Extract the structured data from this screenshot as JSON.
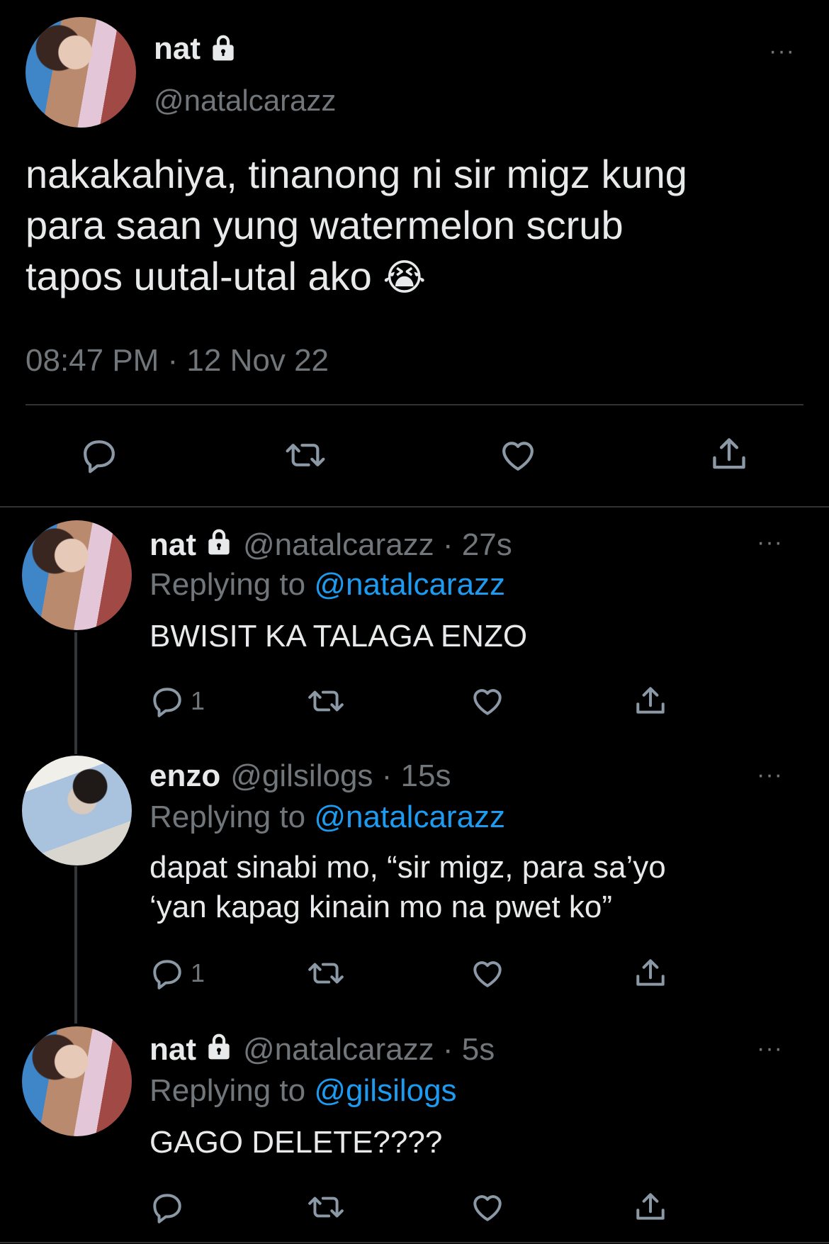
{
  "main_tweet": {
    "name": "nat",
    "handle": "@natalcarazz",
    "text_line1": "nakakahiya, tinanong ni sir migz kung",
    "text_line2": "para saan yung watermelon scrub",
    "text_line3": "tapos uutal-utal ako",
    "emoji": "😭",
    "timestamp": "08:47 PM · 12 Nov 22",
    "more_label": "···",
    "icons": [
      "reply-icon",
      "retweet-icon",
      "like-icon",
      "share-icon"
    ]
  },
  "replies": [
    {
      "name": "nat",
      "handle_time": "@natalcarazz · 27s",
      "replying_label": "Replying to",
      "replying_to": "@natalcarazz",
      "text_line1": "BWISIT KA TALAGA ENZO",
      "text_line2": "",
      "reply_count": "1",
      "more_label": "···"
    },
    {
      "name": "enzo",
      "handle_time": "@gilsilogs · 15s",
      "replying_label": "Replying to",
      "replying_to": "@natalcarazz",
      "text_line1": "dapat sinabi mo, “sir migz, para sa’yo",
      "text_line2": "‘yan kapag kinain mo na pwet ko”",
      "reply_count": "1",
      "more_label": "···"
    },
    {
      "name": "nat",
      "handle_time": "@natalcarazz · 5s",
      "replying_label": "Replying to",
      "replying_to": "@gilsilogs",
      "text_line1": "GAGO DELETE????",
      "text_line2": "",
      "reply_count": "",
      "more_label": "···"
    }
  ],
  "colors": {
    "background": "#000000",
    "text": "#e7e9ea",
    "muted": "#71767b",
    "link": "#1d9bf0",
    "divider": "#2f3336"
  }
}
